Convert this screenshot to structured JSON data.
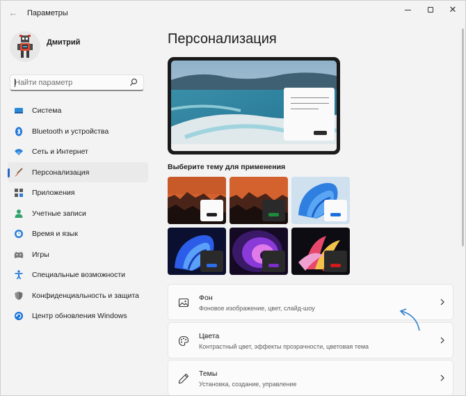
{
  "window": {
    "title": "Параметры",
    "controls": [
      "minimize-icon",
      "maximize-icon",
      "close-icon"
    ]
  },
  "user": {
    "name": "Дмитрий"
  },
  "search": {
    "placeholder": "Найти параметр",
    "value": ""
  },
  "sidebar": {
    "items": [
      {
        "label": "Система",
        "icon": "monitor-icon",
        "active": false
      },
      {
        "label": "Bluetooth и устройства",
        "icon": "bluetooth-icon",
        "active": false
      },
      {
        "label": "Сеть и Интернет",
        "icon": "wifi-icon",
        "active": false
      },
      {
        "label": "Персонализация",
        "icon": "brush-icon",
        "active": true
      },
      {
        "label": "Приложения",
        "icon": "apps-icon",
        "active": false
      },
      {
        "label": "Учетные записи",
        "icon": "person-icon",
        "active": false
      },
      {
        "label": "Время и язык",
        "icon": "globe-clock-icon",
        "active": false
      },
      {
        "label": "Игры",
        "icon": "gamepad-icon",
        "active": false
      },
      {
        "label": "Специальные возможности",
        "icon": "accessibility-icon",
        "active": false
      },
      {
        "label": "Конфиденциальность и защита",
        "icon": "shield-icon",
        "active": false
      },
      {
        "label": "Центр обновления Windows",
        "icon": "update-icon",
        "active": false
      }
    ]
  },
  "main": {
    "title": "Персонализация",
    "theme_heading": "Выберите тему для применения",
    "themes": [
      {
        "name": "theme-1",
        "accent": "#1f1f1f"
      },
      {
        "name": "theme-2",
        "accent": "#1e8a3c"
      },
      {
        "name": "theme-3",
        "accent": "#1a6fe0"
      },
      {
        "name": "theme-4",
        "accent": "#2d6ee8"
      },
      {
        "name": "theme-5",
        "accent": "#7b2fc8"
      },
      {
        "name": "theme-6",
        "accent": "#d11b1b"
      }
    ],
    "settings": [
      {
        "title": "Фон",
        "subtitle": "Фоновое изображение, цвет, слайд-шоу",
        "icon": "image-icon"
      },
      {
        "title": "Цвета",
        "subtitle": "Контрастный цвет, эффекты прозрачности, цветовая тема",
        "icon": "palette-icon"
      },
      {
        "title": "Темы",
        "subtitle": "Установка, создание, управление",
        "icon": "pen-icon"
      }
    ]
  },
  "colors": {
    "accent": "#2a64c8",
    "annotation_arrow": "#2f7fd0"
  }
}
